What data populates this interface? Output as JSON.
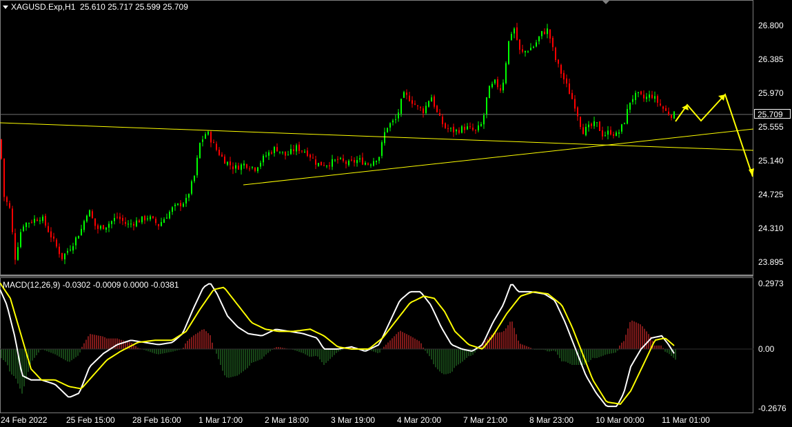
{
  "header": {
    "symbol_label": "XAGUSD.Exp,H1",
    "ohlc": "25.610 25.717 25.599 25.709"
  },
  "macd_header": "MACD(12,26,9) -0.0302 -0.0009 0.0000 -0.0381",
  "price_axis": [
    "26.800",
    "26.385",
    "25.970",
    "25.555",
    "25.140",
    "24.725",
    "24.310",
    "23.895"
  ],
  "current_price": "25.709",
  "macd_axis": [
    "0.2973",
    "0.00",
    "-0.2676"
  ],
  "time_axis": [
    "24 Feb 2022",
    "25 Feb 15:00",
    "28 Feb 16:00",
    "1 Mar 17:00",
    "2 Mar 18:00",
    "3 Mar 19:00",
    "4 Mar 20:00",
    "7 Mar 21:00",
    "8 Mar 23:00",
    "10 Mar 00:00",
    "11 Mar 01:00"
  ],
  "colors": {
    "bull": "#00ff00",
    "bear": "#ff0000",
    "grid": "#808080",
    "trendline": "#ffff00",
    "macd_line": "#ffffff",
    "signal_line": "#ffff00",
    "hist_pos": "#ff3333",
    "hist_neg": "#2e8b2e"
  },
  "icons": {
    "menu": "triangle-down-icon"
  },
  "chart_data": {
    "type": "candlestick",
    "symbol": "XAGUSD.Exp",
    "timeframe": "H1",
    "price_ylim": [
      23.7,
      27.1
    ],
    "close_path": [
      [
        0,
        25.4
      ],
      [
        6,
        24.7
      ],
      [
        14,
        24.55
      ],
      [
        22,
        23.95
      ],
      [
        32,
        24.35
      ],
      [
        45,
        24.4
      ],
      [
        60,
        24.45
      ],
      [
        75,
        24.2
      ],
      [
        90,
        23.95
      ],
      [
        104,
        24.1
      ],
      [
        118,
        24.3
      ],
      [
        128,
        24.55
      ],
      [
        140,
        24.3
      ],
      [
        155,
        24.35
      ],
      [
        170,
        24.45
      ],
      [
        185,
        24.35
      ],
      [
        200,
        24.4
      ],
      [
        215,
        24.45
      ],
      [
        230,
        24.35
      ],
      [
        250,
        24.55
      ],
      [
        270,
        24.65
      ],
      [
        282,
        24.95
      ],
      [
        290,
        25.35
      ],
      [
        300,
        25.5
      ],
      [
        312,
        25.3
      ],
      [
        325,
        25.15
      ],
      [
        340,
        25.05
      ],
      [
        355,
        25.1
      ],
      [
        370,
        25.05
      ],
      [
        385,
        25.2
      ],
      [
        400,
        25.3
      ],
      [
        415,
        25.2
      ],
      [
        430,
        25.3
      ],
      [
        445,
        25.25
      ],
      [
        460,
        25.1
      ],
      [
        475,
        25.1
      ],
      [
        490,
        25.15
      ],
      [
        505,
        25.1
      ],
      [
        520,
        25.15
      ],
      [
        535,
        25.1
      ],
      [
        550,
        25.2
      ],
      [
        560,
        25.55
      ],
      [
        575,
        25.65
      ],
      [
        585,
        25.95
      ],
      [
        595,
        25.9
      ],
      [
        605,
        25.8
      ],
      [
        615,
        25.75
      ],
      [
        625,
        25.95
      ],
      [
        635,
        25.7
      ],
      [
        645,
        25.55
      ],
      [
        660,
        25.5
      ],
      [
        675,
        25.55
      ],
      [
        690,
        25.5
      ],
      [
        700,
        25.6
      ],
      [
        708,
        26.0
      ],
      [
        718,
        26.1
      ],
      [
        728,
        26.0
      ],
      [
        738,
        26.6
      ],
      [
        745,
        26.8
      ],
      [
        755,
        26.45
      ],
      [
        765,
        26.5
      ],
      [
        775,
        26.55
      ],
      [
        785,
        26.7
      ],
      [
        795,
        26.75
      ],
      [
        805,
        26.4
      ],
      [
        815,
        26.2
      ],
      [
        825,
        26.0
      ],
      [
        835,
        25.8
      ],
      [
        845,
        25.5
      ],
      [
        855,
        25.55
      ],
      [
        865,
        25.6
      ],
      [
        875,
        25.45
      ],
      [
        885,
        25.5
      ],
      [
        895,
        25.45
      ],
      [
        905,
        25.6
      ],
      [
        915,
        25.9
      ],
      [
        925,
        25.95
      ],
      [
        935,
        25.9
      ],
      [
        945,
        25.95
      ],
      [
        955,
        25.85
      ],
      [
        965,
        25.75
      ],
      [
        975,
        25.7
      ],
      [
        980,
        25.71
      ]
    ],
    "trendlines": [
      {
        "from": [
          "24 Feb 2022",
          25.62
        ],
        "to": [
          "11 Mar 01:00+",
          25.28
        ]
      },
      {
        "from": [
          "2 Mar 18:00",
          24.87
        ],
        "to": [
          "11 Mar 01:00+",
          25.56
        ]
      }
    ],
    "forecast_arrows": [
      25.71,
      25.86,
      25.67,
      25.97,
      24.96
    ],
    "macd": {
      "params": [
        12,
        26,
        9
      ],
      "values": {
        "macd": -0.0302,
        "signal": -0.0009,
        "extra": 0.0,
        "histogram": -0.0381
      },
      "ylim": [
        -0.3,
        0.32
      ],
      "macd_line": [
        [
          0,
          0.27
        ],
        [
          10,
          0.2
        ],
        [
          22,
          0.05
        ],
        [
          32,
          -0.12
        ],
        [
          45,
          -0.14
        ],
        [
          60,
          -0.14
        ],
        [
          80,
          -0.16
        ],
        [
          100,
          -0.22
        ],
        [
          115,
          -0.2
        ],
        [
          130,
          -0.08
        ],
        [
          150,
          -0.02
        ],
        [
          170,
          0.02
        ],
        [
          190,
          0.04
        ],
        [
          210,
          0.03
        ],
        [
          230,
          0.02
        ],
        [
          250,
          0.03
        ],
        [
          265,
          0.07
        ],
        [
          280,
          0.18
        ],
        [
          295,
          0.28
        ],
        [
          305,
          0.3
        ],
        [
          315,
          0.25
        ],
        [
          330,
          0.15
        ],
        [
          345,
          0.1
        ],
        [
          360,
          0.07
        ],
        [
          380,
          0.06
        ],
        [
          400,
          0.09
        ],
        [
          420,
          0.08
        ],
        [
          440,
          0.07
        ],
        [
          460,
          0.05
        ],
        [
          470,
          0.0
        ],
        [
          490,
          0.0
        ],
        [
          510,
          0.01
        ],
        [
          530,
          -0.01
        ],
        [
          550,
          0.02
        ],
        [
          565,
          0.12
        ],
        [
          580,
          0.22
        ],
        [
          595,
          0.26
        ],
        [
          610,
          0.26
        ],
        [
          625,
          0.2
        ],
        [
          640,
          0.1
        ],
        [
          655,
          0.02
        ],
        [
          670,
          0.0
        ],
        [
          685,
          -0.01
        ],
        [
          700,
          0.02
        ],
        [
          715,
          0.12
        ],
        [
          730,
          0.2
        ],
        [
          742,
          0.3
        ],
        [
          752,
          0.26
        ],
        [
          770,
          0.26
        ],
        [
          790,
          0.25
        ],
        [
          805,
          0.22
        ],
        [
          820,
          0.12
        ],
        [
          835,
          0.0
        ],
        [
          850,
          -0.12
        ],
        [
          865,
          -0.2
        ],
        [
          880,
          -0.26
        ],
        [
          895,
          -0.26
        ],
        [
          905,
          -0.2
        ],
        [
          915,
          -0.08
        ],
        [
          930,
          0.0
        ],
        [
          945,
          0.05
        ],
        [
          960,
          0.06
        ],
        [
          970,
          0.02
        ],
        [
          980,
          -0.03
        ]
      ],
      "signal_line": [
        [
          0,
          0.3
        ],
        [
          15,
          0.23
        ],
        [
          30,
          0.07
        ],
        [
          45,
          -0.09
        ],
        [
          60,
          -0.14
        ],
        [
          80,
          -0.14
        ],
        [
          100,
          -0.17
        ],
        [
          118,
          -0.18
        ],
        [
          135,
          -0.12
        ],
        [
          155,
          -0.05
        ],
        [
          175,
          -0.01
        ],
        [
          200,
          0.03
        ],
        [
          225,
          0.04
        ],
        [
          250,
          0.04
        ],
        [
          270,
          0.08
        ],
        [
          290,
          0.18
        ],
        [
          310,
          0.27
        ],
        [
          325,
          0.28
        ],
        [
          345,
          0.2
        ],
        [
          365,
          0.12
        ],
        [
          385,
          0.09
        ],
        [
          405,
          0.08
        ],
        [
          425,
          0.08
        ],
        [
          450,
          0.09
        ],
        [
          470,
          0.06
        ],
        [
          490,
          0.01
        ],
        [
          510,
          0.0
        ],
        [
          535,
          0.0
        ],
        [
          555,
          0.05
        ],
        [
          575,
          0.13
        ],
        [
          595,
          0.21
        ],
        [
          615,
          0.24
        ],
        [
          630,
          0.23
        ],
        [
          645,
          0.17
        ],
        [
          660,
          0.08
        ],
        [
          680,
          0.02
        ],
        [
          700,
          0.0
        ],
        [
          715,
          0.06
        ],
        [
          735,
          0.16
        ],
        [
          755,
          0.24
        ],
        [
          775,
          0.26
        ],
        [
          795,
          0.25
        ],
        [
          815,
          0.2
        ],
        [
          830,
          0.1
        ],
        [
          845,
          -0.02
        ],
        [
          860,
          -0.14
        ],
        [
          880,
          -0.24
        ],
        [
          900,
          -0.25
        ],
        [
          915,
          -0.19
        ],
        [
          935,
          -0.06
        ],
        [
          950,
          0.04
        ],
        [
          965,
          0.05
        ],
        [
          980,
          0.01
        ]
      ]
    }
  }
}
